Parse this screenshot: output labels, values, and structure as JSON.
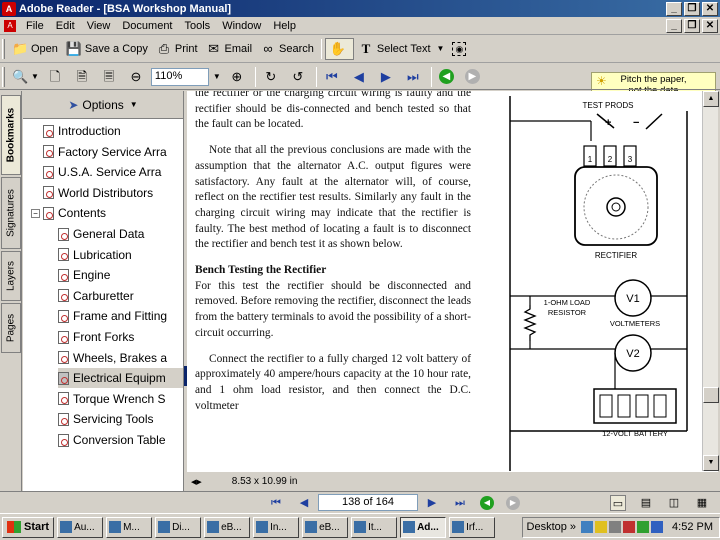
{
  "window": {
    "title": "Adobe Reader - [BSA Workshop Manual]",
    "min": "_",
    "restore": "❐",
    "close": "✕"
  },
  "menu": [
    "File",
    "Edit",
    "View",
    "Document",
    "Tools",
    "Window",
    "Help"
  ],
  "toolbar": {
    "open": "Open",
    "save_copy": "Save a Copy",
    "print": "Print",
    "email": "Email",
    "search": "Search",
    "select_text": "Select Text",
    "zoom": "110%",
    "hint_line1": "Pitch the paper,",
    "hint_line2": "not the data"
  },
  "side_tabs": [
    "Bookmarks",
    "Signatures",
    "Layers",
    "Pages"
  ],
  "bookmarks": {
    "header": "Options",
    "items": [
      {
        "label": "Introduction",
        "level": 1
      },
      {
        "label": "Factory Service Arra",
        "level": 1
      },
      {
        "label": "U.S.A. Service Arra",
        "level": 1
      },
      {
        "label": "World Distributors",
        "level": 1
      },
      {
        "label": "Contents",
        "level": 0
      },
      {
        "label": "General Data",
        "level": 2
      },
      {
        "label": "Lubrication",
        "level": 2
      },
      {
        "label": "Engine",
        "level": 2
      },
      {
        "label": "Carburetter",
        "level": 2
      },
      {
        "label": "Frame and Fitting",
        "level": 2
      },
      {
        "label": "Front Forks",
        "level": 2
      },
      {
        "label": "Wheels, Brakes a",
        "level": 2
      },
      {
        "label": "Electrical Equipm",
        "level": 2
      },
      {
        "label": "Torque Wrench S",
        "level": 2
      },
      {
        "label": "Servicing Tools",
        "level": 2
      },
      {
        "label": "Conversion Table",
        "level": 2
      }
    ],
    "selected_index": 12
  },
  "document": {
    "p1": "the rectifier or the charging circuit wiring is faulty and the rectifier should be dis-connected and bench tested so that the fault can be located.",
    "p2": "Note that all the previous conclusions are made with the assumption that the alternator A.C. output figures were satisfactory. Any fault at the alternator will, of course, reflect on the rectifier test results. Similarly any fault in the charging circuit wiring may indicate that the rectifier is faulty. The best method of locating a fault is to disconnect the rectifier and bench test it as shown below.",
    "heading": "Bench Testing the Rectifier",
    "p3": "For this test the rectifier should be disconnected and removed. Before removing the rectifier, disconnect the leads from the battery terminals to avoid the possibility of a short-circuit occurring.",
    "p4": "Connect the rectifier to a fully charged 12 volt battery of approximately 40 ampere/hours capacity at the 10 hour rate, and 1 ohm load resistor, and then connect the D.C. voltmeter"
  },
  "diagram": {
    "test_prods": "TEST PRODS",
    "plus": "+",
    "minus": "−",
    "t1": "1",
    "t2": "2",
    "t3": "3",
    "rectifier": "RECTIFIER",
    "load_resistor_line1": "1-OHM LOAD",
    "load_resistor_line2": "RESISTOR",
    "v1": "V1",
    "v2": "V2",
    "voltmeters": "VOLTMETERS",
    "battery": "12-VOLT BATTERY"
  },
  "status": {
    "page_size": "8.53 x 10.99 in",
    "page_display": "138 of 164"
  },
  "taskbar": {
    "start": "Start",
    "tasks": [
      "Au...",
      "M...",
      "Di...",
      "eB...",
      "In...",
      "eB...",
      "It...",
      "Ad...",
      "Irf..."
    ],
    "active_index": 7,
    "desktop": "Desktop",
    "chevron": "»",
    "clock": "4:52 PM"
  }
}
